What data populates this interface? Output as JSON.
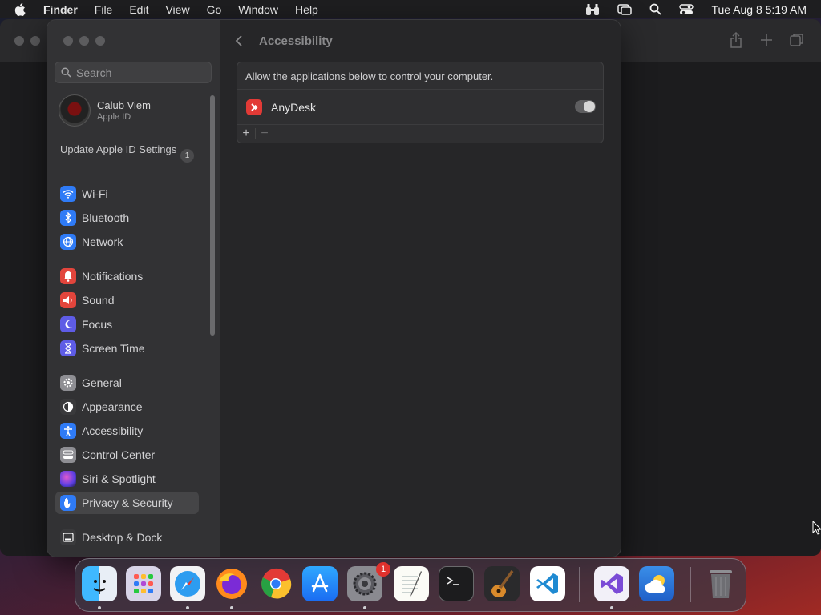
{
  "menubar": {
    "items": [
      "Finder",
      "File",
      "Edit",
      "View",
      "Go",
      "Window",
      "Help"
    ],
    "clock": "Tue Aug 8  5:19 AM"
  },
  "settings": {
    "search_placeholder": "Search",
    "profile": {
      "name": "Calub Viem",
      "subtitle": "Apple ID"
    },
    "update": {
      "label": "Update Apple ID Settings",
      "count": "1"
    },
    "sidebar": [
      {
        "label": "Wi-Fi",
        "icon": "wifi-icon",
        "color": "#2f7bf6"
      },
      {
        "label": "Bluetooth",
        "icon": "bluetooth-icon",
        "color": "#2f7bf6"
      },
      {
        "label": "Network",
        "icon": "globe-icon",
        "color": "#2f7bf6"
      },
      {
        "label": "Notifications",
        "icon": "bell-icon",
        "color": "#e2453c"
      },
      {
        "label": "Sound",
        "icon": "speaker-icon",
        "color": "#e2453c"
      },
      {
        "label": "Focus",
        "icon": "moon-icon",
        "color": "#5e5ce6"
      },
      {
        "label": "Screen Time",
        "icon": "hourglass-icon",
        "color": "#5e5ce6"
      },
      {
        "label": "General",
        "icon": "gear-icon",
        "color": "#8e8e93"
      },
      {
        "label": "Appearance",
        "icon": "appearance-icon",
        "color": "#3a3a3c"
      },
      {
        "label": "Accessibility",
        "icon": "accessibility-icon",
        "color": "#2f7bf6"
      },
      {
        "label": "Control Center",
        "icon": "control-center-icon",
        "color": "#8e8e93"
      },
      {
        "label": "Siri & Spotlight",
        "icon": "siri-icon",
        "color": "#b04ad6"
      },
      {
        "label": "Privacy & Security",
        "icon": "hand-icon",
        "color": "#2f7bf6"
      },
      {
        "label": "Desktop & Dock",
        "icon": "dock-icon",
        "color": "#3a3a3c"
      }
    ],
    "active_item": "Privacy & Security",
    "content": {
      "title": "Accessibility",
      "description": "Allow the applications below to control your computer.",
      "apps": [
        {
          "name": "AnyDesk",
          "enabled": true
        }
      ],
      "add_label": "+",
      "remove_label": "−"
    }
  },
  "dock": {
    "apps": [
      "Finder",
      "Launchpad",
      "Safari",
      "Firefox",
      "Chrome",
      "App Store",
      "System Settings",
      "TextEdit",
      "Terminal",
      "GarageBand",
      "Visual Studio Code",
      "Visual Studio",
      "Weather",
      "Trash"
    ],
    "settings_badge": "1"
  }
}
